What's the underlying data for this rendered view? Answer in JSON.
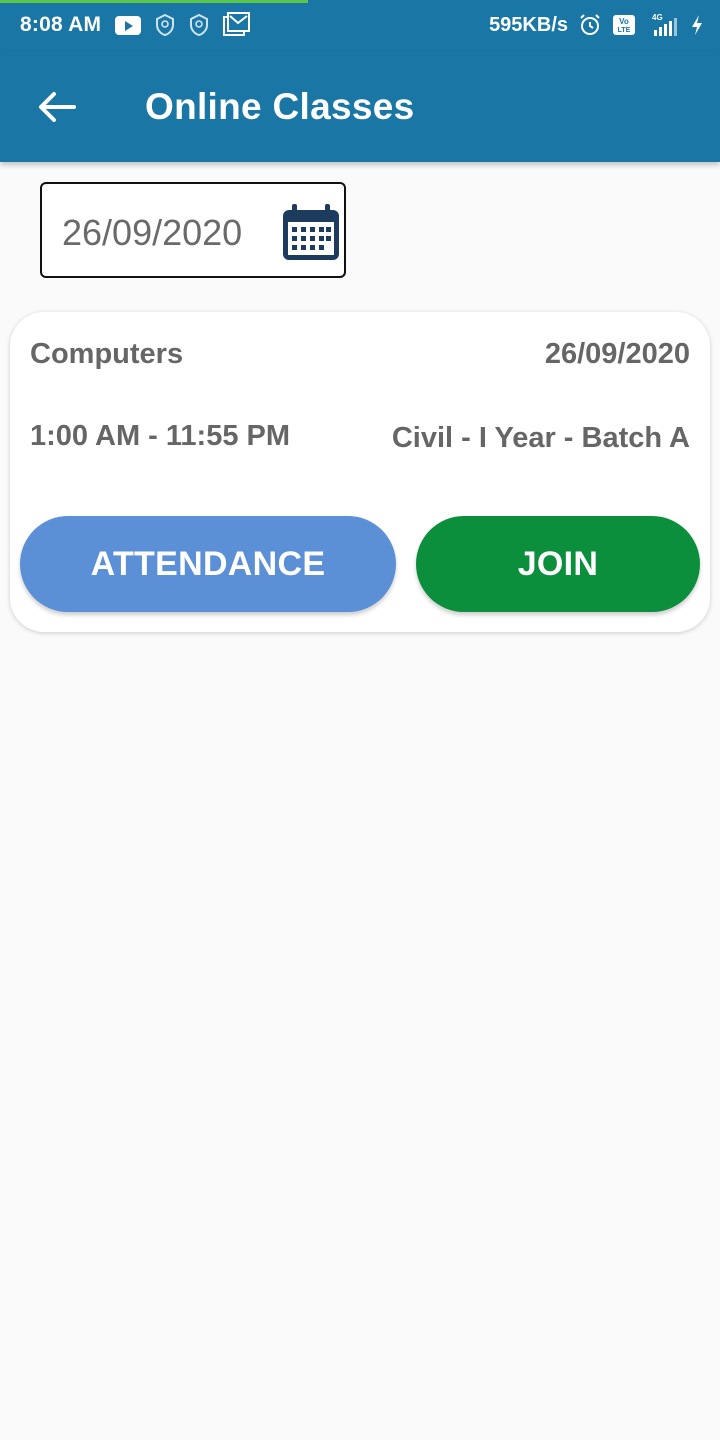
{
  "status_bar": {
    "time": "8:08 AM",
    "net_speed": "595KB/s",
    "left_icons": [
      "youtube-icon",
      "shield-icon",
      "shield-icon",
      "gmail-icon"
    ],
    "right_icons": [
      "alarm-icon",
      "volte-icon",
      "signal-4g-icon",
      "charging-icon"
    ],
    "network_label": "4G",
    "volte_label": "Vo LTE"
  },
  "app_bar": {
    "title": "Online Classes",
    "back_icon": "arrow-back-icon",
    "background_color": "#1a77a5"
  },
  "date_filter": {
    "value": "26/09/2020",
    "icon": "calendar-icon"
  },
  "classes": [
    {
      "subject": "Computers",
      "date": "26/09/2020",
      "time": "1:00 AM - 11:55 PM",
      "batch": "Civil - I Year - Batch A",
      "attendance_label": "ATTENDANCE",
      "join_label": "JOIN",
      "attendance_color": "#5b8fd6",
      "join_color": "#0b8f3c"
    }
  ]
}
